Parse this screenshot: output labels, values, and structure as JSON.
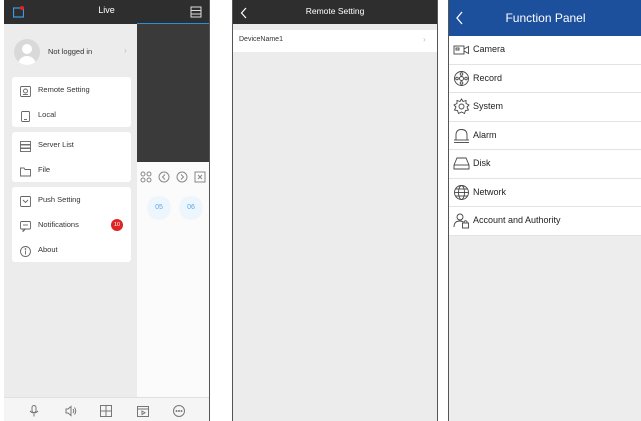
{
  "live": {
    "title": "Live",
    "profile": {
      "name": "Not logged in"
    },
    "menu_groups": [
      [
        {
          "label": "Remote Setting",
          "icon": "remote-setting-icon"
        },
        {
          "label": "Local",
          "icon": "phone-icon"
        }
      ],
      [
        {
          "label": "Server List",
          "icon": "server-list-icon"
        },
        {
          "label": "File",
          "icon": "folder-icon"
        }
      ],
      [
        {
          "label": "Push Setting",
          "icon": "push-icon"
        },
        {
          "label": "Notifications",
          "icon": "message-icon",
          "badge": "10"
        },
        {
          "label": "About",
          "icon": "info-icon"
        }
      ]
    ],
    "channels": [
      "05",
      "06"
    ],
    "bottom_icons": [
      "microphone-icon",
      "speaker-icon",
      "grid-icon",
      "playback-icon",
      "more-icon"
    ]
  },
  "remote_setting": {
    "title": "Remote Setting",
    "devices": [
      "DeviceName1"
    ]
  },
  "function_panel": {
    "title": "Function Panel",
    "items": [
      {
        "label": "Camera",
        "icon": "camera-icon"
      },
      {
        "label": "Record",
        "icon": "record-icon"
      },
      {
        "label": "System",
        "icon": "system-icon"
      },
      {
        "label": "Alarm",
        "icon": "alarm-icon"
      },
      {
        "label": "Disk",
        "icon": "disk-icon"
      },
      {
        "label": "Network",
        "icon": "network-icon"
      },
      {
        "label": "Account and Authority",
        "icon": "account-icon"
      }
    ]
  },
  "colors": {
    "dark_bar": "#2e2e2e",
    "blue_bar": "#1c4f9c",
    "badge": "#e02424",
    "accent": "#2b8fdc"
  }
}
